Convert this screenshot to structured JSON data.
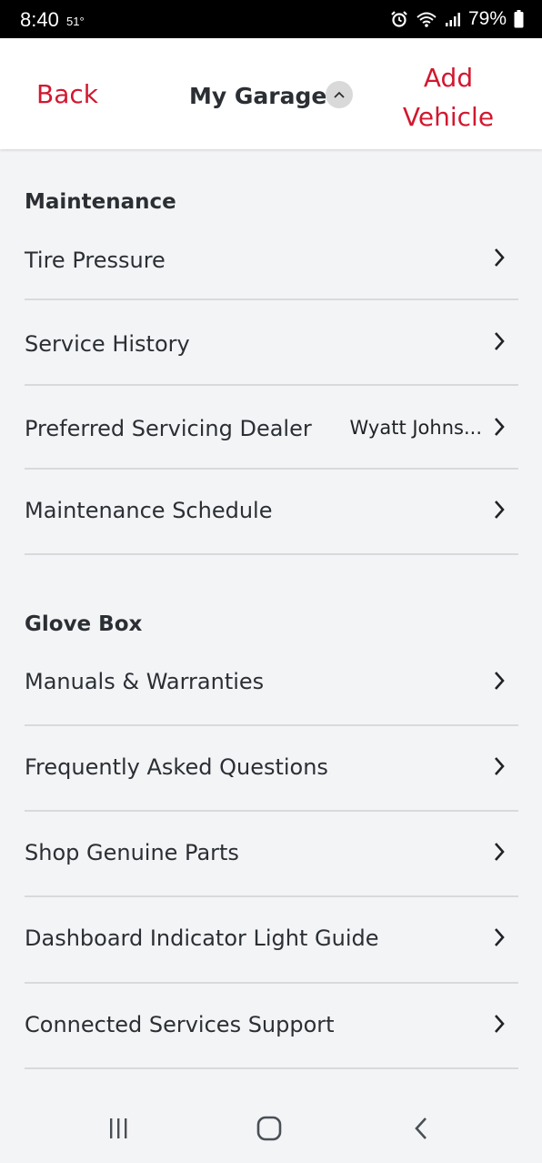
{
  "status_bar": {
    "time": "8:40",
    "temperature": "51°",
    "battery": "79%"
  },
  "header": {
    "back_label": "Back",
    "title": "My Garage",
    "add_vehicle_label_line1": "Add",
    "add_vehicle_label_line2": "Vehicle"
  },
  "maintenance": {
    "title": "Maintenance",
    "items": [
      {
        "label": "Tire Pressure"
      },
      {
        "label": "Service History"
      },
      {
        "label": "Preferred Servicing Dealer",
        "value": "Wyatt Johns..."
      },
      {
        "label": "Maintenance Schedule"
      }
    ]
  },
  "glove_box": {
    "title": "Glove Box",
    "items": [
      {
        "label": "Manuals & Warranties"
      },
      {
        "label": "Frequently Asked Questions"
      },
      {
        "label": "Shop Genuine Parts"
      },
      {
        "label": "Dashboard Indicator Light Guide"
      },
      {
        "label": "Connected Services Support"
      }
    ]
  },
  "colors": {
    "accent": "#d1182f",
    "background": "#f3f4f6",
    "divider": "#d7dadd"
  }
}
